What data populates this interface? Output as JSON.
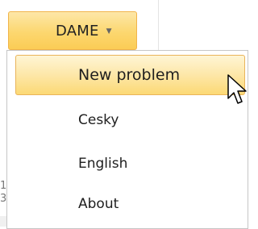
{
  "toolbar": {
    "dropdown_label": "DAME",
    "dropdown_caret_icon": "triangle-down"
  },
  "menu": {
    "items": [
      {
        "label": "New problem",
        "state": "highlighted"
      },
      {
        "label": "Cesky",
        "state": "normal"
      },
      {
        "label": "English",
        "state": "normal"
      },
      {
        "label": "About",
        "state": "normal"
      }
    ]
  },
  "background": {
    "left_digits": [
      "1",
      "3"
    ]
  },
  "colors": {
    "accent_fill": "#fcd76f",
    "accent_border": "#f1b44a",
    "menu_border": "#c6c6c6"
  },
  "cursor": {
    "icon": "mouse-pointer-icon"
  }
}
